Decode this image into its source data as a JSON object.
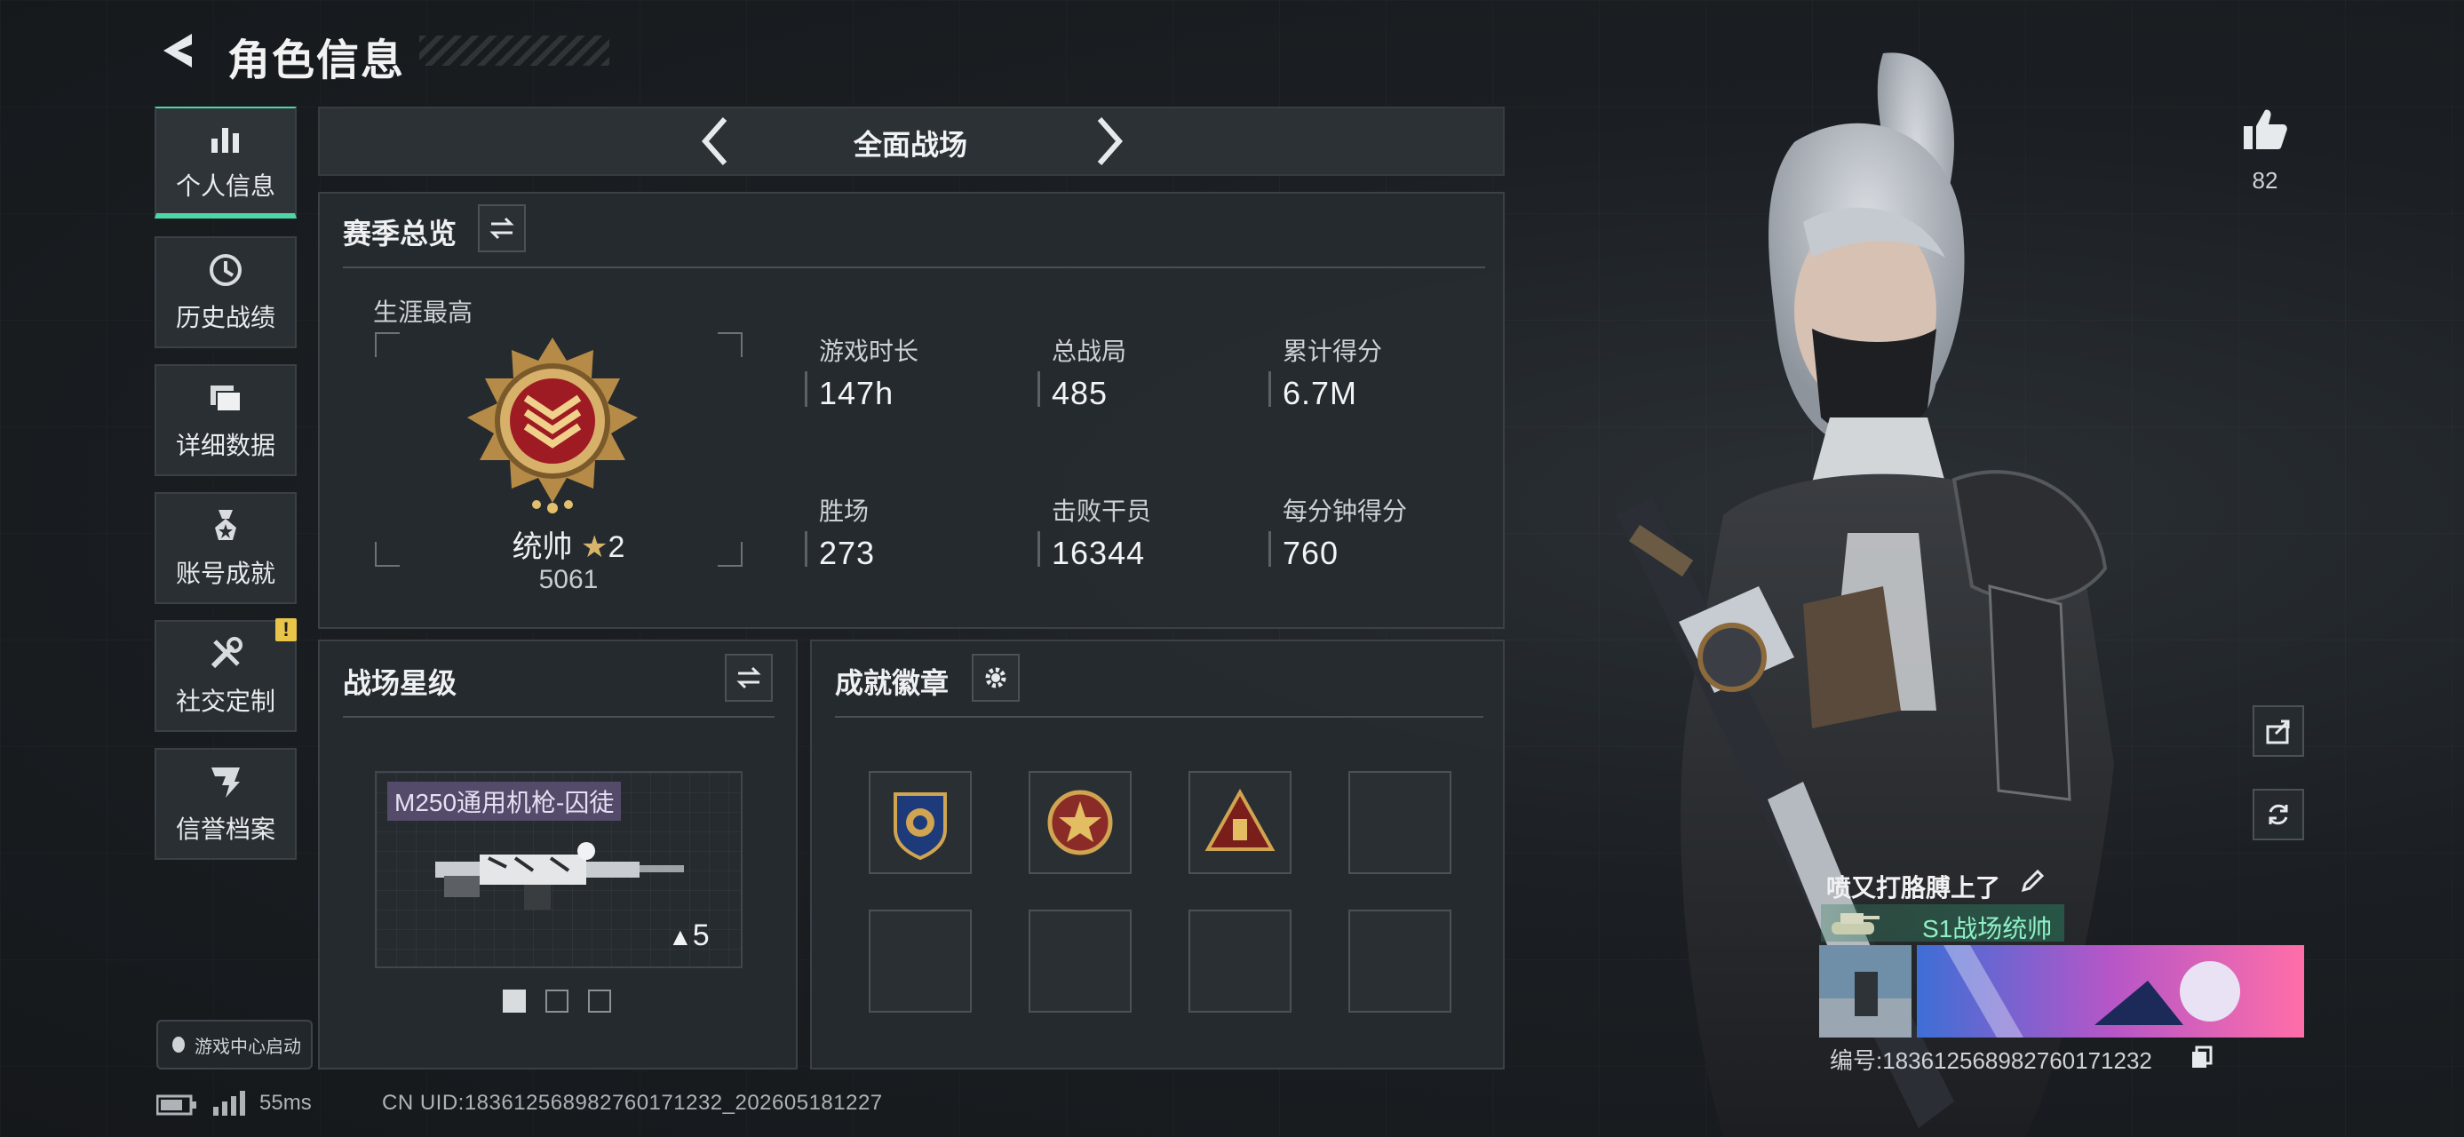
{
  "header": {
    "title": "角色信息"
  },
  "sidebar": {
    "items": [
      {
        "label": "个人信息",
        "icon": "bar-chart-icon",
        "active": true
      },
      {
        "label": "历史战绩",
        "icon": "history-clock-icon"
      },
      {
        "label": "详细数据",
        "icon": "folder-icon"
      },
      {
        "label": "账号成就",
        "icon": "medal-icon"
      },
      {
        "label": "社交定制",
        "icon": "tools-icon"
      },
      {
        "label": "信誉档案",
        "icon": "credit-shield-icon"
      }
    ],
    "warning_badge": "!",
    "launch_label": "游戏中心启动"
  },
  "mode_selector": {
    "label": "全面战场"
  },
  "season_overview": {
    "title": "赛季总览",
    "career_label": "生涯最高",
    "rank_name": "统帅",
    "rank_stars": "2",
    "rank_score": "5061",
    "stats": [
      {
        "label": "游戏时长",
        "value": "147h"
      },
      {
        "label": "总战局",
        "value": "485"
      },
      {
        "label": "累计得分",
        "value": "6.7M"
      },
      {
        "label": "胜场",
        "value": "273"
      },
      {
        "label": "击败干员",
        "value": "16344"
      },
      {
        "label": "每分钟得分",
        "value": "760"
      }
    ]
  },
  "battlefield_stars": {
    "title": "战场星级",
    "weapon_name": "M250通用机枪-囚徒",
    "weapon_level": "5",
    "pages_total": 3,
    "page_active": 1
  },
  "achievements": {
    "title": "成就徽章",
    "badges": [
      "shield-badge-icon",
      "star-emblem-badge-icon",
      "triangle-badge-icon",
      "",
      "",
      "",
      "",
      ""
    ]
  },
  "profile": {
    "likes": "82",
    "player_name": "喷又打胳膊上了",
    "title_text": "S1战场统帅",
    "uid_label": "编号:18361256898​2760171232"
  },
  "footer": {
    "ping": "55ms",
    "uid": "CN UID:18361256898276017​1232_202605181227"
  },
  "colors": {
    "accent": "#4fd6a6",
    "warning": "#e8c44a",
    "panel": "#262b30"
  }
}
